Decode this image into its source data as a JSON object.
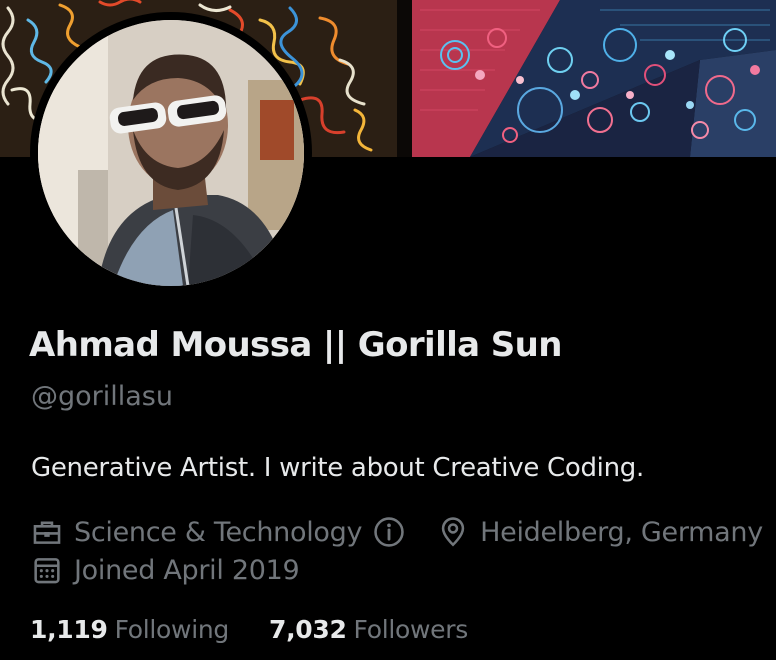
{
  "profile": {
    "display_name": "Ahmad Moussa || Gorilla Sun",
    "handle": "@gorillasu",
    "bio": "Generative Artist. I write about Creative Coding.",
    "category": "Science & Technology",
    "location": "Heidelberg, Germany",
    "joined": "Joined April 2019"
  },
  "stats": {
    "following_count": "1,119",
    "following_label": "Following",
    "followers_count": "7,032",
    "followers_label": "Followers"
  },
  "icons": {
    "category": "briefcase-icon",
    "info": "info-circle-icon",
    "location": "location-pin-icon",
    "joined": "calendar-icon"
  },
  "colors": {
    "background": "#000000",
    "primary_text": "#e7e9ea",
    "secondary_text": "#71767b"
  }
}
